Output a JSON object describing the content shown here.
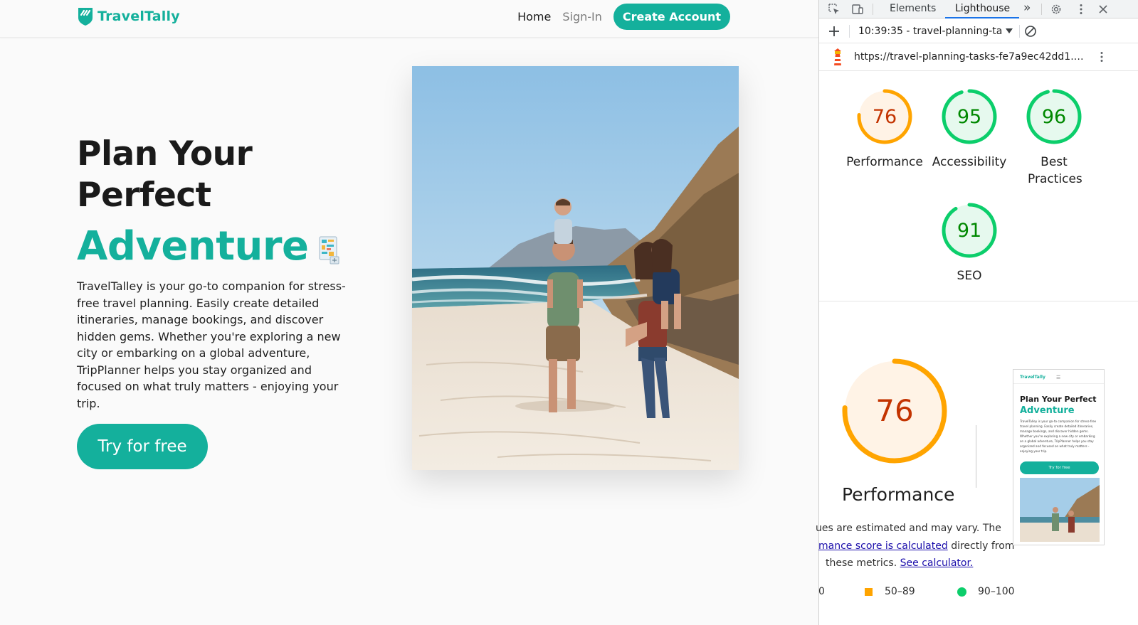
{
  "site": {
    "brand": "TravelTally",
    "nav": {
      "home": "Home",
      "signin": "Sign-In",
      "create_account": "Create Account"
    },
    "hero": {
      "title_line1": "Plan Your",
      "title_line2": "Perfect",
      "title_accent": "Adventure",
      "description": "TravelTalley is your go-to companion for stress-free travel planning. Easily create detailed itineraries, manage bookings, and discover hidden gems. Whether you're exploring a new city or embarking on a global adventure, TripPlanner helps you stay organized and focused on what truly matters - enjoying your trip.",
      "cta": "Try for free"
    },
    "colors": {
      "brand": "#14b09c",
      "text": "#1a1a1a"
    }
  },
  "devtools": {
    "tabs": {
      "elements": "Elements",
      "lighthouse": "Lighthouse",
      "more": "»"
    },
    "report_select": "10:39:35 - travel-planning-ta",
    "url": "https://travel-planning-tasks-fe7a9ec42dd1.he...",
    "scores": [
      {
        "label": "Performance",
        "value": "76",
        "fraction": 0.76,
        "status": "average"
      },
      {
        "label": "Accessibility",
        "value": "95",
        "fraction": 0.95,
        "status": "pass"
      },
      {
        "label": "Best Practices",
        "value": "96",
        "fraction": 0.96,
        "status": "pass"
      },
      {
        "label": "SEO",
        "value": "91",
        "fraction": 0.91,
        "status": "pass"
      }
    ],
    "performance_detail": {
      "score": "76",
      "label": "Performance",
      "text_line1_prefix": "ues are estimated and may vary. The",
      "text_line2_link": "mance score is calculated",
      "text_line2_suffix": " directly from",
      "text_line3_prefix": "these metrics. ",
      "text_line3_link": "See calculator."
    },
    "legend": {
      "fail_mark": "0",
      "average": "50–89",
      "pass": "90–100"
    },
    "thumbnail": {
      "brand": "TravelTally",
      "menu": "☰",
      "title": "Plan Your Perfect",
      "accent": "Adventure",
      "description": "TravelTalley is your go-to companion for stress-free travel planning. Easily create detailed itineraries, manage bookings, and discover hidden gems. Whether you're exploring a new city or embarking on a global adventure, TripPlanner helps you stay organized and focused on what truly matters - enjoying your trip.",
      "cta": "Try for free"
    },
    "colors": {
      "average": "#ffa400",
      "average_text": "#c33300",
      "pass": "#0cce6b",
      "pass_text": "#008800"
    }
  }
}
